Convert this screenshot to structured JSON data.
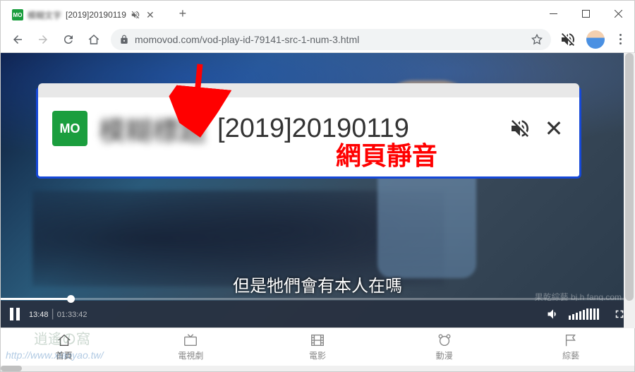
{
  "window": {
    "tab_title_blurred": "模糊文字",
    "tab_title_suffix": "[2019]20190119",
    "favicon_text": "MO"
  },
  "addressbar": {
    "url": "momovod.com/vod-play-id-79141-src-1-num-3.html"
  },
  "overlay": {
    "favicon_text": "MO",
    "title_blurred": "模糊標題",
    "title_suffix": "[2019]20190119",
    "annotation": "網頁靜音"
  },
  "video": {
    "current_time": "13:48",
    "total_time": "01:33:42",
    "subtitle": "但是牠們會有本人在嗎",
    "corner_watermark": "果乾綜藝 bj.h fang.com"
  },
  "nav": {
    "items": [
      {
        "label": "首頁"
      },
      {
        "label": "電視劇"
      },
      {
        "label": "電影"
      },
      {
        "label": "動漫"
      },
      {
        "label": "綜藝"
      }
    ]
  },
  "watermark": {
    "url": "http://www.xiaoyao.tw/",
    "logo": "逍遙の窩"
  }
}
